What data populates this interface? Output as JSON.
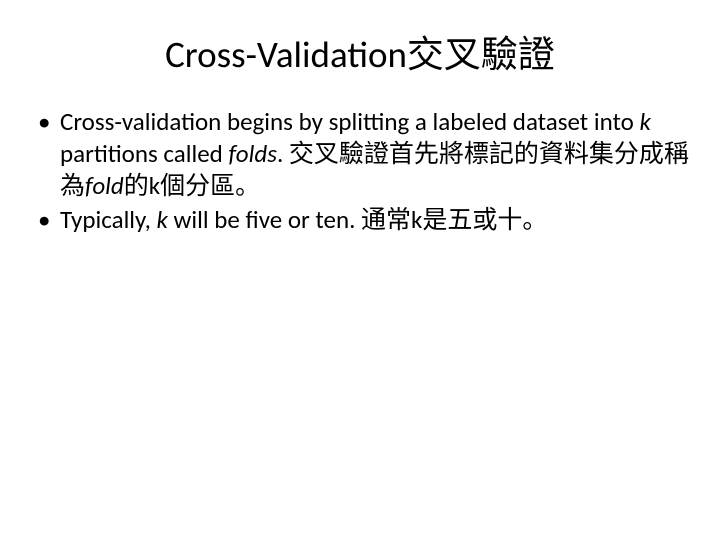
{
  "title": "Cross-Validation交叉驗證",
  "bullets": [
    {
      "seg1": "Cross-validation begins by splitting a labeled dataset into ",
      "seg2_italic": "k",
      "seg3": " partitions called ",
      "seg4_italic": "folds",
      "seg5": ". 交叉驗證首先將標記的資料集分成稱為",
      "seg6_italic": "fold",
      "seg7": "的k個分區。"
    },
    {
      "seg1": "Typically, ",
      "seg2_italic": "k",
      "seg3": " will be five or ten. 通常k是五或十。"
    }
  ]
}
